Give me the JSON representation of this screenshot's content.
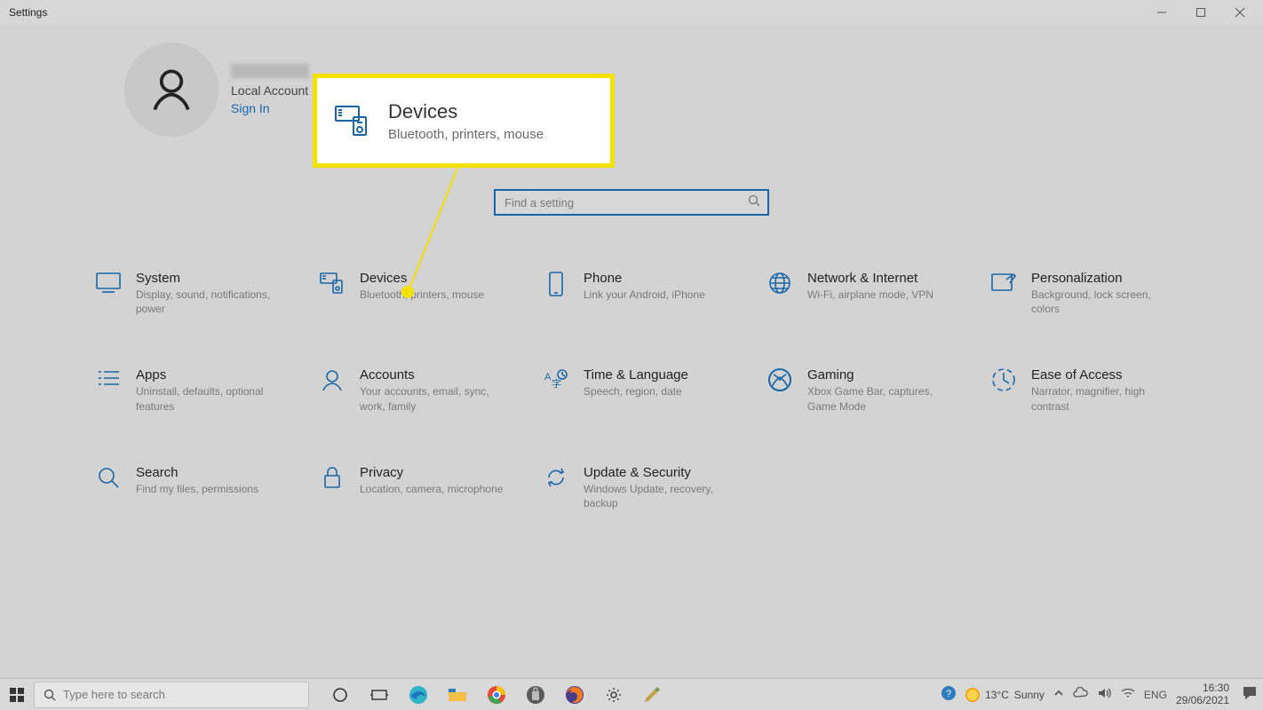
{
  "header": {
    "title": "Settings"
  },
  "account": {
    "name_blurred": true,
    "type": "Local Account",
    "sign_in": "Sign In"
  },
  "callout": {
    "title": "Devices",
    "subtitle": "Bluetooth, printers, mouse"
  },
  "search": {
    "placeholder": "Find a setting"
  },
  "tiles": [
    {
      "id": "system",
      "title": "System",
      "subtitle": "Display, sound, notifications, power"
    },
    {
      "id": "devices",
      "title": "Devices",
      "subtitle": "Bluetooth, printers, mouse"
    },
    {
      "id": "phone",
      "title": "Phone",
      "subtitle": "Link your Android, iPhone"
    },
    {
      "id": "network",
      "title": "Network & Internet",
      "subtitle": "Wi-Fi, airplane mode, VPN"
    },
    {
      "id": "personalization",
      "title": "Personalization",
      "subtitle": "Background, lock screen, colors"
    },
    {
      "id": "apps",
      "title": "Apps",
      "subtitle": "Uninstall, defaults, optional features"
    },
    {
      "id": "accounts",
      "title": "Accounts",
      "subtitle": "Your accounts, email, sync, work, family"
    },
    {
      "id": "time",
      "title": "Time & Language",
      "subtitle": "Speech, region, date"
    },
    {
      "id": "gaming",
      "title": "Gaming",
      "subtitle": "Xbox Game Bar, captures, Game Mode"
    },
    {
      "id": "ease",
      "title": "Ease of Access",
      "subtitle": "Narrator, magnifier, high contrast"
    },
    {
      "id": "search",
      "title": "Search",
      "subtitle": "Find my files, permissions"
    },
    {
      "id": "privacy",
      "title": "Privacy",
      "subtitle": "Location, camera, microphone"
    },
    {
      "id": "update",
      "title": "Update & Security",
      "subtitle": "Windows Update, recovery, backup"
    }
  ],
  "taskbar": {
    "search_placeholder": "Type here to search",
    "weather": {
      "temp": "13°C",
      "cond": "Sunny"
    },
    "lang": "ENG",
    "time": "16:30",
    "date": "29/06/2021"
  }
}
